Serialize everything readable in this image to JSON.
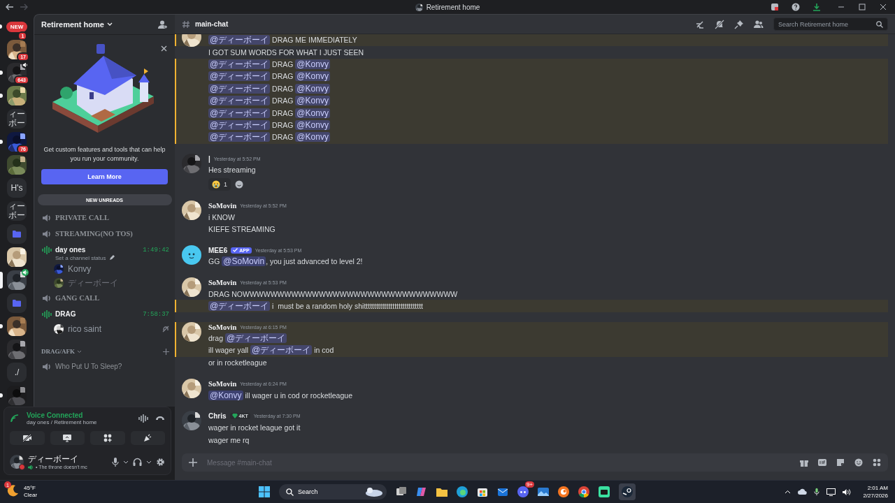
{
  "window": {
    "title": "Retirement home"
  },
  "servers": [
    {
      "kind": "new",
      "label": "NEW",
      "badge": "1",
      "unread": true,
      "selected": false,
      "voice": false
    },
    {
      "kind": "picture",
      "badge": "17",
      "unread": false,
      "selected": false,
      "voice": false
    },
    {
      "kind": "picture",
      "badge": "643",
      "unread": true,
      "selected": false,
      "voice": true
    },
    {
      "kind": "picture",
      "unread": true,
      "selected": false,
      "voice": false
    },
    {
      "kind": "text",
      "label": "ィーボー",
      "unread": false,
      "selected": false,
      "voice": false
    },
    {
      "kind": "picture",
      "badge": "76",
      "unread": true,
      "selected": false,
      "voice": false
    },
    {
      "kind": "picture",
      "unread": false,
      "selected": false,
      "voice": false
    },
    {
      "kind": "text",
      "label": "H's",
      "unread": false,
      "selected": false,
      "voice": false
    },
    {
      "kind": "text",
      "label": "ィーボー",
      "unread": false,
      "selected": false,
      "voice": false
    },
    {
      "kind": "folder",
      "unread": false,
      "selected": false,
      "voice": false
    },
    {
      "kind": "picture",
      "unread": false,
      "selected": false,
      "voice": false
    },
    {
      "kind": "picture",
      "unread": false,
      "selected": true,
      "voice": true
    },
    {
      "kind": "folder",
      "unread": false,
      "selected": false,
      "voice": false
    },
    {
      "kind": "picture",
      "unread": true,
      "selected": false,
      "voice": false
    },
    {
      "kind": "picture",
      "unread": false,
      "selected": false,
      "voice": false
    },
    {
      "kind": "text",
      "label": "./",
      "unread": false,
      "selected": false,
      "voice": false
    },
    {
      "kind": "picture",
      "unread": true,
      "selected": false,
      "voice": false
    }
  ],
  "server_header": {
    "name": "Retirement home"
  },
  "promo": {
    "text": "Get custom features and tools that can help you run your community.",
    "button": "Learn More"
  },
  "new_unreads": "NEW UNREADS",
  "channels": [
    {
      "kind": "voice",
      "name": "PRIVATE CALL",
      "active": false
    },
    {
      "kind": "voice",
      "name": "STREAMING(NO TOS)",
      "active": false
    },
    {
      "kind": "voice",
      "name": "day ones",
      "active": true,
      "timer": "1:49:42",
      "status": "Set a channel status",
      "members": [
        {
          "name": "Konvy",
          "deafened": false
        },
        {
          "name": "ディーボーイ",
          "deafened": false
        }
      ]
    },
    {
      "kind": "voice",
      "name": "GANG CALL",
      "active": false
    },
    {
      "kind": "voice",
      "name": "DRAG",
      "active": true,
      "timer": "7:58:37",
      "members": [
        {
          "name": "rico saint",
          "deafened": true
        }
      ]
    },
    {
      "kind": "category",
      "name": "DRAG/AFK"
    },
    {
      "kind": "voice",
      "name": "Who Put U To Sleep?",
      "active": false,
      "plain": true
    }
  ],
  "voice_panel": {
    "status": "Voice Connected",
    "location": "day ones / Retirement home"
  },
  "user_panel": {
    "name": "ディーボーイ",
    "status": "• The throne doesn't mc"
  },
  "chat": {
    "channel": "main-chat",
    "search_placeholder": "Search Retirement home",
    "input_placeholder": "Message #main-chat"
  },
  "messages": [
    {
      "kind": "user",
      "lines": [
        {
          "highlighted": true,
          "parts": [
            {
              "kind": "mention",
              "text": "@ディーボーイ"
            },
            {
              "kind": "text",
              "text": " DRAG ME IMMEDIATELY"
            }
          ]
        },
        {
          "highlighted": false,
          "parts": [
            {
              "kind": "text",
              "text": "I GOT SUM WORDS FOR WHAT I JUST SEEN"
            }
          ]
        },
        {
          "highlighted": true,
          "parts": [
            {
              "kind": "mention",
              "text": "@ディーボーイ"
            },
            {
              "kind": "text",
              "text": " DRAG "
            },
            {
              "kind": "mention",
              "text": "@Konvy"
            }
          ]
        },
        {
          "highlighted": true,
          "parts": [
            {
              "kind": "mention",
              "text": "@ディーボーイ"
            },
            {
              "kind": "text",
              "text": " DRAG "
            },
            {
              "kind": "mention",
              "text": "@Konvy"
            }
          ]
        },
        {
          "highlighted": true,
          "parts": [
            {
              "kind": "mention",
              "text": "@ディーボーイ"
            },
            {
              "kind": "text",
              "text": " DRAG "
            },
            {
              "kind": "mention",
              "text": "@Konvy"
            }
          ]
        },
        {
          "highlighted": true,
          "parts": [
            {
              "kind": "mention",
              "text": "@ディーボーイ"
            },
            {
              "kind": "text",
              "text": " DRAG "
            },
            {
              "kind": "mention",
              "text": "@Konvy"
            }
          ]
        },
        {
          "highlighted": true,
          "parts": [
            {
              "kind": "mention",
              "text": "@ディーボーイ"
            },
            {
              "kind": "text",
              "text": " DRAG "
            },
            {
              "kind": "mention",
              "text": "@Konvy"
            }
          ]
        },
        {
          "highlighted": true,
          "parts": [
            {
              "kind": "mention",
              "text": "@ディーボーイ"
            },
            {
              "kind": "text",
              "text": " DRAG "
            },
            {
              "kind": "mention",
              "text": "@Konvy"
            }
          ]
        },
        {
          "highlighted": true,
          "parts": [
            {
              "kind": "mention",
              "text": "@ディーボーイ"
            },
            {
              "kind": "text",
              "text": " DRAG "
            },
            {
              "kind": "mention",
              "text": "@Konvy"
            }
          ]
        }
      ]
    },
    {
      "kind": "user",
      "author": "|",
      "time": "Yesterday at 5:52 PM",
      "lines": [
        {
          "highlighted": false,
          "parts": [
            {
              "kind": "text",
              "text": "Hes streaming"
            }
          ]
        }
      ],
      "reactions": [
        {
          "count": "1"
        }
      ]
    },
    {
      "kind": "user",
      "author": "SoMovin",
      "time": "Yesterday at 5:52 PM",
      "lines": [
        {
          "highlighted": false,
          "parts": [
            {
              "kind": "text",
              "text": "i KNOW"
            }
          ]
        },
        {
          "highlighted": false,
          "parts": [
            {
              "kind": "text",
              "text": "KIEFE STREAMING"
            }
          ]
        }
      ]
    },
    {
      "kind": "bot",
      "author": "MEE6",
      "tag": {
        "kind": "app",
        "text": "APP"
      },
      "time": "Yesterday at 5:53 PM",
      "lines": [
        {
          "highlighted": false,
          "parts": [
            {
              "kind": "text",
              "text": "GG "
            },
            {
              "kind": "mention",
              "text": "@SoMovin"
            },
            {
              "kind": "text",
              "text": ", you just advanced to level 2!"
            }
          ]
        }
      ]
    },
    {
      "kind": "user",
      "author": "SoMovin",
      "time": "Yesterday at 5:53 PM",
      "lines": [
        {
          "highlighted": false,
          "parts": [
            {
              "kind": "text",
              "text": "DRAG NOWWWWWWWWWWWWWWWWWWWWWWWWWWWWWWW"
            }
          ]
        },
        {
          "highlighted": true,
          "parts": [
            {
              "kind": "mention",
              "text": "@ディーボーイ"
            },
            {
              "kind": "text",
              "text": " i  must be a random holy shittttttttttttttttttttttttttttt"
            }
          ]
        }
      ]
    },
    {
      "kind": "user",
      "author": "SoMovin",
      "time": "Yesterday at 6:15 PM",
      "header_highlighted": true,
      "lines": [
        {
          "highlighted": true,
          "parts": [
            {
              "kind": "text",
              "text": "drag "
            },
            {
              "kind": "mention",
              "text": "@ディーボーイ"
            }
          ]
        },
        {
          "highlighted": true,
          "parts": [
            {
              "kind": "text",
              "text": "ill wager yall "
            },
            {
              "kind": "mention",
              "text": "@ディーボーイ"
            },
            {
              "kind": "text",
              "text": " in cod"
            }
          ]
        },
        {
          "highlighted": false,
          "parts": [
            {
              "kind": "text",
              "text": "or in rocketleague"
            }
          ]
        }
      ]
    },
    {
      "kind": "user",
      "author": "SoMovin",
      "time": "Yesterday at 6:24 PM",
      "lines": [
        {
          "highlighted": false,
          "parts": [
            {
              "kind": "mention",
              "text": "@Konvy"
            },
            {
              "kind": "text",
              "text": " ill wager u in cod or rocketleague"
            }
          ]
        }
      ]
    },
    {
      "kind": "user",
      "author": "Chris",
      "tag": {
        "kind": "gem",
        "text": "4KT"
      },
      "time": "Yesterday at 7:30 PM",
      "lines": [
        {
          "highlighted": false,
          "parts": [
            {
              "kind": "text",
              "text": "wager in rocket league got it"
            }
          ]
        },
        {
          "highlighted": false,
          "parts": [
            {
              "kind": "text",
              "text": "wager me rq"
            }
          ]
        }
      ]
    }
  ],
  "taskbar": {
    "temperature": "45°F",
    "condition": "Clear",
    "weather_badge": "1",
    "search": "Search",
    "app_badge": "9+",
    "time": "2:01 AM",
    "date": "2/27/2026"
  }
}
